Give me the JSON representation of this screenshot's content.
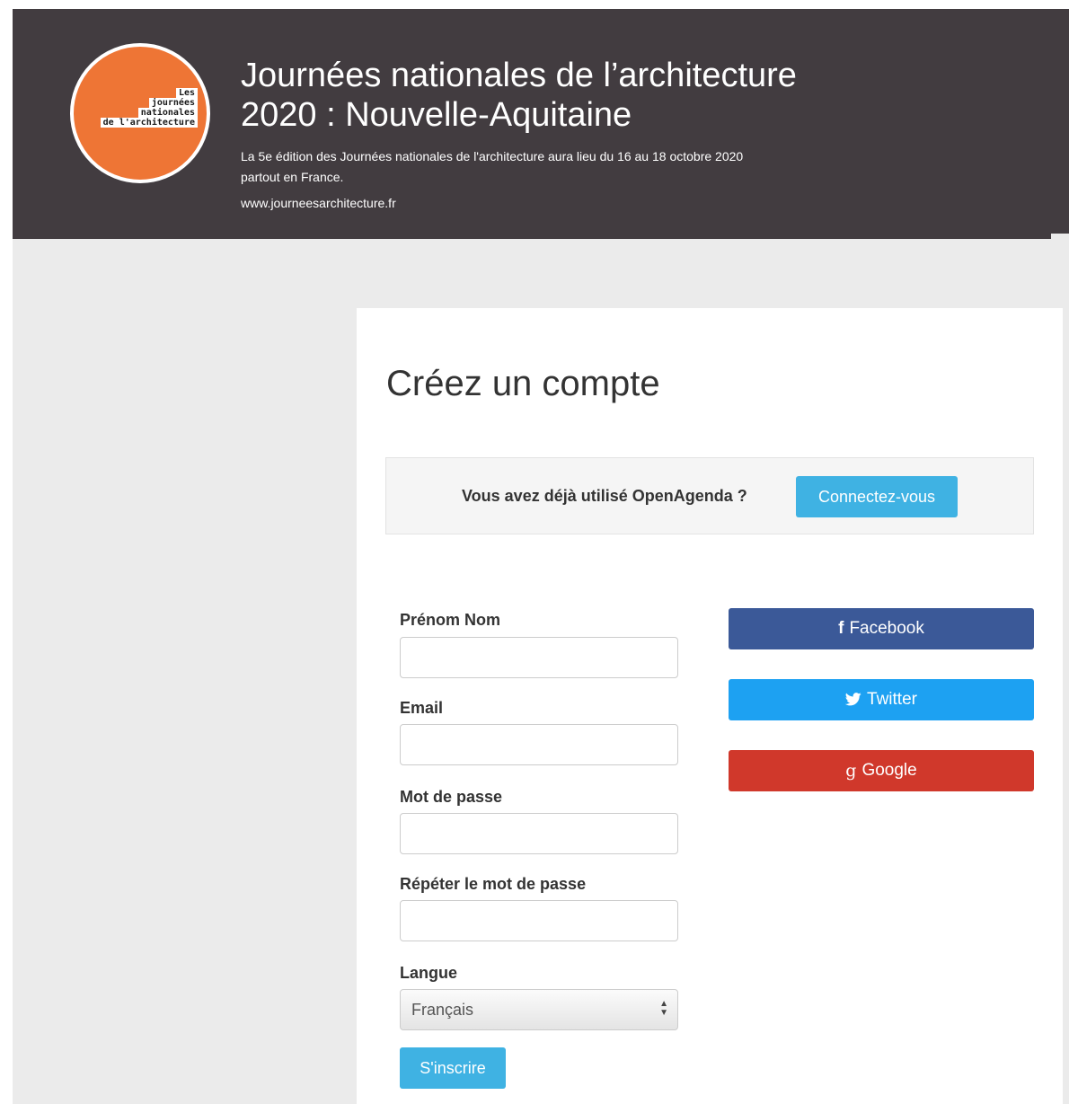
{
  "header": {
    "logo_lines": [
      "Les",
      "journées",
      "nationales",
      "de l'architecture"
    ],
    "title_line1": "Journées nationales de l’architecture",
    "title_line2": "2020 : Nouvelle-Aquitaine",
    "description": "La 5e édition des Journées nationales de l'architecture aura lieu du 16 au 18 octobre 2020 partout en France.",
    "link": "www.journeesarchitecture.fr"
  },
  "card": {
    "title": "Créez un compte",
    "login_prompt": "Vous avez déjà utilisé OpenAgenda ?",
    "login_button": "Connectez-vous"
  },
  "form": {
    "name_label": "Prénom Nom",
    "name_value": "",
    "email_label": "Email",
    "email_value": "",
    "password_label": "Mot de passe",
    "password_value": "",
    "password_repeat_label": "Répéter le mot de passe",
    "password_repeat_value": "",
    "language_label": "Langue",
    "language_selected": "Français",
    "submit_label": "S'inscrire"
  },
  "social": {
    "facebook_label": "Facebook",
    "facebook_icon": "facebook-icon",
    "facebook_color": "#3b5998",
    "twitter_label": "Twitter",
    "twitter_icon": "twitter-icon",
    "twitter_color": "#1da1f2",
    "google_label": "Google",
    "google_icon": "google-icon",
    "google_color": "#d0382b"
  },
  "colors": {
    "header_bg": "#423c40",
    "logo_orange": "#ee7535",
    "accent_blue": "#3fb2e3",
    "page_bg": "#ebebeb"
  }
}
